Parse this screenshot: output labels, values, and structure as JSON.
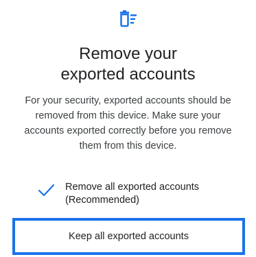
{
  "header": {
    "icon": "delete-list-icon",
    "title_line1": "Remove your",
    "title_line2": "exported accounts"
  },
  "description": "For your security, exported accounts should be removed from this device. Make sure your accounts exported correctly before you remove them from this device.",
  "options": [
    {
      "label_line1": "Remove all exported accounts",
      "label_line2": "(Recommended)",
      "selected": true
    },
    {
      "label": "Keep all exported accounts",
      "selected": false
    }
  ],
  "colors": {
    "accent": "#1a73e8",
    "text": "#202124"
  }
}
